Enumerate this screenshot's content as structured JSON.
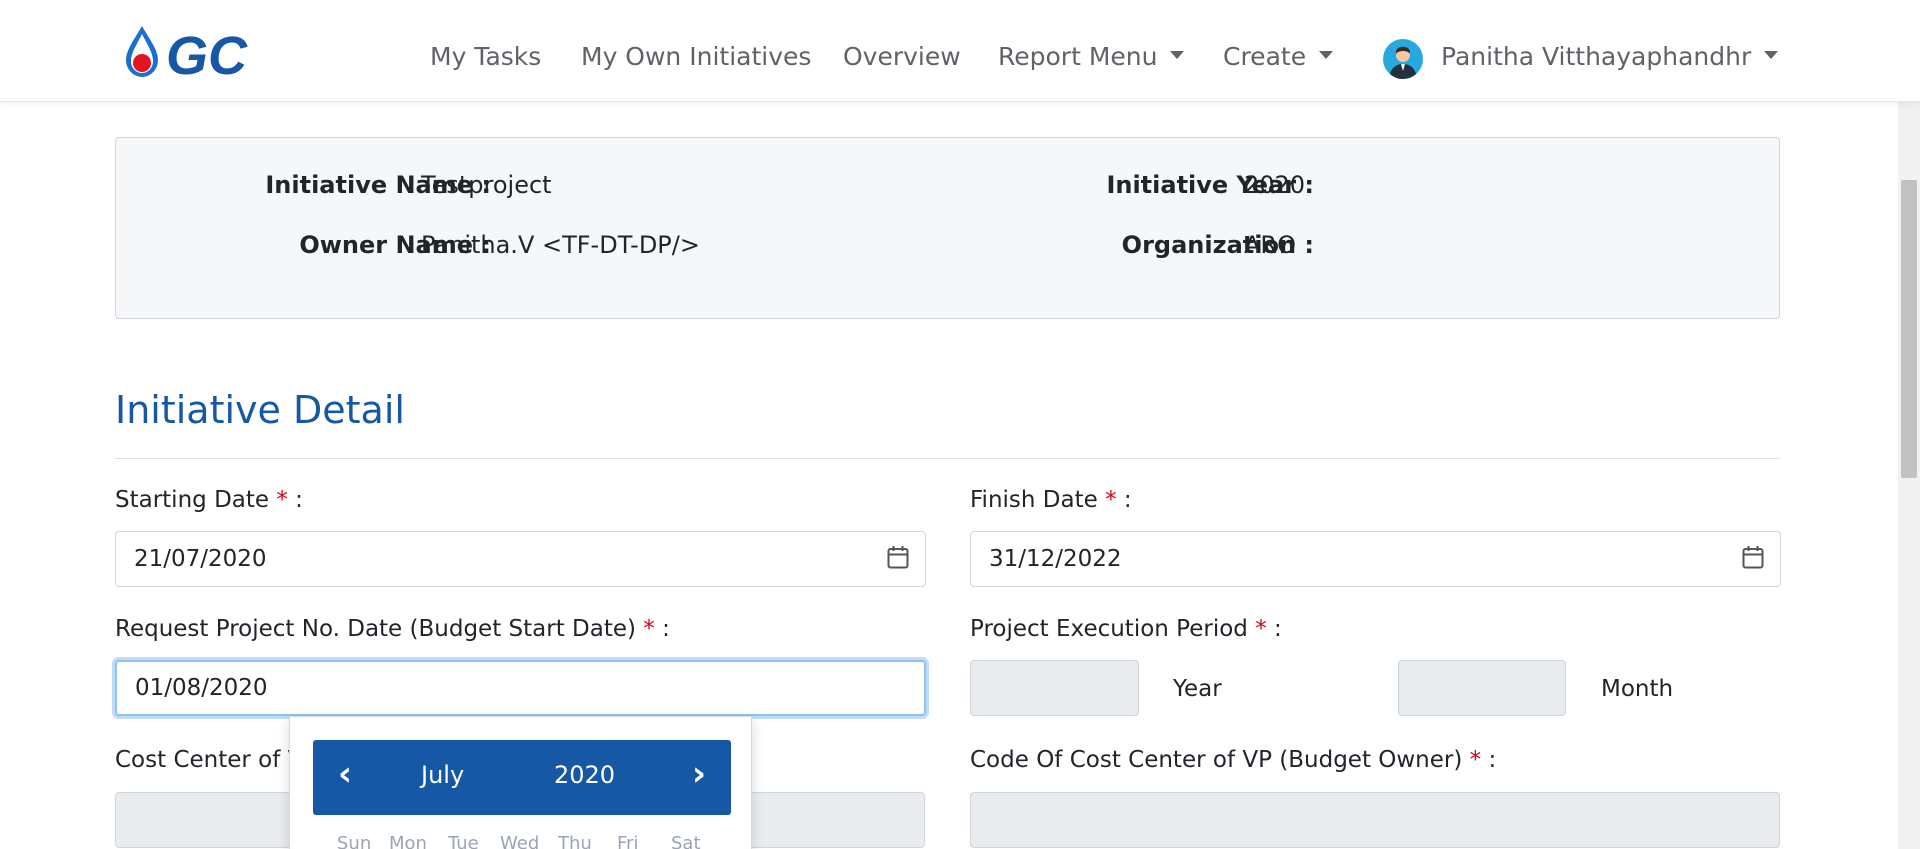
{
  "nav": {
    "logo_text": "GC",
    "items": [
      {
        "label": "My Tasks"
      },
      {
        "label": "My Own Initiatives"
      },
      {
        "label": "Overview"
      },
      {
        "label": "Report Menu"
      },
      {
        "label": "Create"
      }
    ],
    "user_name": "Panitha Vitthayaphandhr"
  },
  "info": {
    "initiative_name_label": "Initiative Name :",
    "initiative_name": "Testproject",
    "owner_name_label": "Owner Name :",
    "owner_name": "Panitha.V <TF-DT-DP/>",
    "initiative_year_label": "Initiative Year :",
    "initiative_year": "2020",
    "organization_label": "Organization :",
    "organization": "ARO"
  },
  "section": {
    "title": "Initiative Detail"
  },
  "form": {
    "required_mark": "*",
    "colon": ":",
    "starting_date_label": "Starting Date",
    "starting_date": "21/07/2020",
    "finish_date_label": "Finish Date",
    "finish_date": "31/12/2022",
    "request_date_label": "Request Project No. Date (Budget Start Date)",
    "request_date": "01/08/2020",
    "execution_period_label": "Project Execution Period",
    "year_label": "Year",
    "month_label": "Month",
    "cost_center_label": "Cost Center of V",
    "code_cost_center_label": "Code Of Cost Center of VP (Budget Owner)"
  },
  "datepicker": {
    "prev": "‹",
    "next": "›",
    "month": "July",
    "year": "2020",
    "weekdays": [
      "Sun",
      "Mon",
      "Tue",
      "Wed",
      "Thu",
      "Fri",
      "Sat"
    ]
  },
  "colors": {
    "brand_blue": "#1658a6",
    "required_red": "#d9001b",
    "focus_ring": "#8ec3ee"
  }
}
